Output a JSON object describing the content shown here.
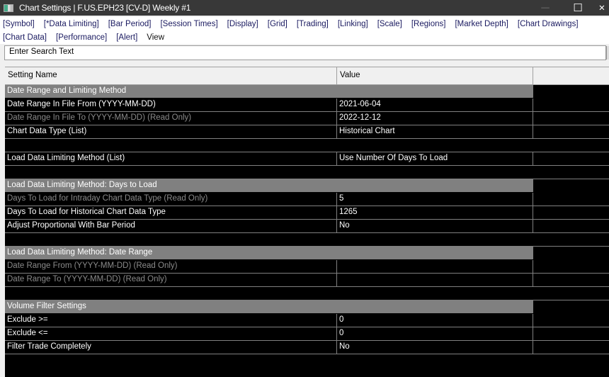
{
  "window": {
    "title": "Chart Settings | F.US.EPH23 [CV-D]  Weekly  #1",
    "minimize": "—",
    "maximize": "☐",
    "close": "✕"
  },
  "tabs_row1": [
    "[Symbol]",
    "[*Data Limiting]",
    "[Bar Period]",
    "[Session Times]",
    "[Display]",
    "[Grid]",
    "[Trading]",
    "[Linking]",
    "[Scale]",
    "[Regions]",
    "[Market Depth]",
    "[Chart Drawings]"
  ],
  "tabs_row2": [
    "[Chart Data]",
    "[Performance]",
    "[Alert]",
    "View"
  ],
  "search": {
    "placeholder": "Enter Search Text"
  },
  "table": {
    "headers": [
      "Setting Name",
      "Value"
    ],
    "rows": [
      {
        "type": "section",
        "name": "Date Range and Limiting Method"
      },
      {
        "type": "row",
        "name": "Date Range In File From (YYYY-MM-DD)",
        "value": "2021-06-04"
      },
      {
        "type": "ro",
        "name": "Date Range In File To (YYYY-MM-DD) (Read Only)",
        "value": "2022-12-12"
      },
      {
        "type": "row",
        "name": "Chart Data Type (List)",
        "value": "Historical Chart"
      },
      {
        "type": "blank"
      },
      {
        "type": "row",
        "name": "Load Data Limiting Method (List)",
        "value": "Use Number Of Days To Load"
      },
      {
        "type": "blank"
      },
      {
        "type": "section",
        "name": "Load Data Limiting Method: Days to Load"
      },
      {
        "type": "ro",
        "name": "Days To Load for Intraday Chart Data Type (Read Only)",
        "value": "5"
      },
      {
        "type": "row",
        "name": "Days To Load for Historical Chart Data Type",
        "value": "1265"
      },
      {
        "type": "row",
        "name": "Adjust Proportional With Bar Period",
        "value": "No"
      },
      {
        "type": "blank"
      },
      {
        "type": "section",
        "name": "Load Data Limiting Method: Date Range"
      },
      {
        "type": "ro",
        "name": "Date Range From (YYYY-MM-DD) (Read Only)",
        "value": ""
      },
      {
        "type": "ro",
        "name": "Date Range To (YYYY-MM-DD) (Read Only)",
        "value": ""
      },
      {
        "type": "blank"
      },
      {
        "type": "section",
        "name": "Volume Filter Settings"
      },
      {
        "type": "row",
        "name": "Exclude >=",
        "value": "0"
      },
      {
        "type": "row",
        "name": "Exclude <=",
        "value": "0"
      },
      {
        "type": "row",
        "name": "Filter Trade Completely",
        "value": "No"
      }
    ]
  }
}
